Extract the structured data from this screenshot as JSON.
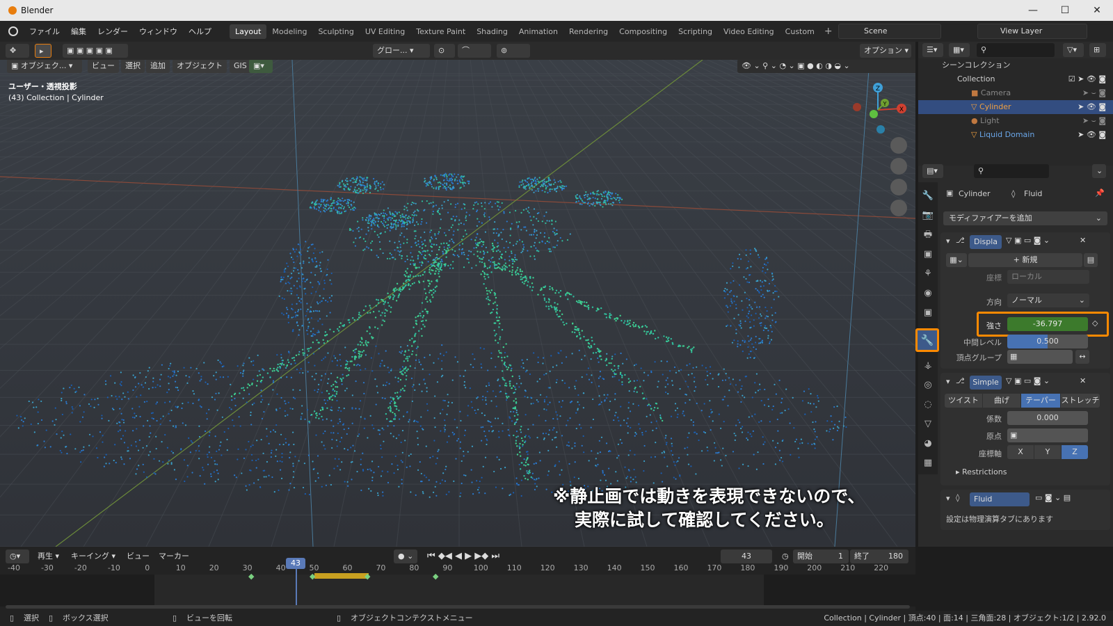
{
  "window": {
    "title": "Blender",
    "minimize": "—",
    "maximize": "☐",
    "close": "✕"
  },
  "menus": [
    "ファイル",
    "編集",
    "レンダー",
    "ウィンドウ",
    "ヘルプ"
  ],
  "workspaces": [
    "Layout",
    "Modeling",
    "Sculpting",
    "UV Editing",
    "Texture Paint",
    "Shading",
    "Animation",
    "Rendering",
    "Compositing",
    "Scripting",
    "Video Editing",
    "Custom"
  ],
  "active_workspace": "Layout",
  "scene": {
    "name": "Scene",
    "view_layer": "View Layer"
  },
  "viewport_header": {
    "mode": "オブジェク...",
    "view": "ビュー",
    "select": "選択",
    "add": "追加",
    "object": "オブジェクト",
    "gis": "GIS",
    "transform": "グロー...",
    "options": "オプション"
  },
  "viewport": {
    "overlay_line1": "ユーザー・透視投影",
    "overlay_line2": "(43) Collection | Cylinder",
    "caption_line1": "※静止画では動きを表現できないので、",
    "caption_line2": "実際に試して確認してください。",
    "axis_x": "X",
    "axis_y": "Y",
    "axis_z": "Z"
  },
  "outliner": {
    "scene_collection": "シーンコレクション",
    "collection": "Collection",
    "items": [
      "Camera",
      "Cylinder",
      "Light",
      "Liquid Domain"
    ]
  },
  "properties": {
    "breadcrumb_object": "Cylinder",
    "breadcrumb_modifier": "Fluid",
    "add_modifier": "モディファイアーを追加",
    "displace": {
      "name": "Displa",
      "new": "新規",
      "coords_label": "座標",
      "coords_value": "ローカル",
      "direction_label": "方向",
      "direction_value": "ノーマル",
      "strength_label": "強さ",
      "strength_value": "-36.797",
      "midlevel_label": "中間レベル",
      "midlevel_value": "0.500",
      "vertex_group_label": "頂点グループ"
    },
    "simple": {
      "name": "Simple",
      "modes": [
        "ツイスト",
        "曲げ",
        "テーパー",
        "ストレッチ"
      ],
      "active_mode": "テーパー",
      "factor_label": "係数",
      "factor_value": "0.000",
      "origin_label": "原点",
      "axis_label": "座標軸",
      "axes": [
        "X",
        "Y",
        "Z"
      ],
      "active_axis": "Z",
      "restrictions": "Restrictions"
    },
    "fluid": {
      "name": "Fluid",
      "note": "設定は物理演算タブにあります"
    }
  },
  "timeline": {
    "playback": "再生",
    "keying": "キーイング",
    "view": "ビュー",
    "marker": "マーカー",
    "current_frame": "43",
    "start_label": "開始",
    "start": "1",
    "end_label": "終了",
    "end": "180",
    "ticks": [
      "-40",
      "-30",
      "-20",
      "-10",
      "0",
      "10",
      "20",
      "30",
      "40",
      "50",
      "60",
      "70",
      "80",
      "90",
      "100",
      "110",
      "120",
      "130",
      "140",
      "150",
      "160",
      "170",
      "180",
      "190",
      "200",
      "210",
      "220"
    ],
    "current_marker": "43"
  },
  "statusbar": {
    "select": "選択",
    "box_select": "ボックス選択",
    "rotate_view": "ビューを回転",
    "context_menu": "オブジェクトコンテクストメニュー",
    "stats": "Collection | Cylinder | 頂点:40 | 面:14 | 三角面:28 | オブジェクト:1/2 | 2.92.0"
  },
  "colors": {
    "accent": "#e87d0d",
    "highlight": "#ff8a00",
    "strength_field": "#3c7a2c",
    "selected_row": "#334d80"
  }
}
